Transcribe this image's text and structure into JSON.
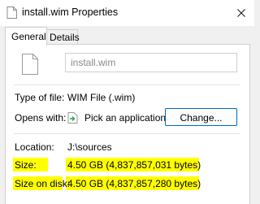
{
  "window": {
    "title": "install.wim Properties",
    "accent_color": "#0067c0",
    "highlight_color": "#ffff00"
  },
  "tabs": [
    {
      "label": "General",
      "active": true
    },
    {
      "label": "Details",
      "active": false
    }
  ],
  "general": {
    "file_name": "install.wim",
    "type_label": "Type of file:",
    "type_value": "WIM File (.wim)",
    "opens_label": "Opens with:",
    "opens_value": "Pick an application",
    "change_button": "Change...",
    "location_label": "Location:",
    "location_value": "J:\\sources",
    "size_label": "Size:",
    "size_value": "4.50 GB (4,837,857,031 bytes)",
    "size_on_disk_label": "Size on disk:",
    "size_on_disk_value": "4.50 GB (4,837,857,280 bytes)"
  },
  "icons": {
    "title": "document-icon",
    "file": "document-icon",
    "opens_with": "pick-app-icon",
    "close": "close-icon"
  }
}
